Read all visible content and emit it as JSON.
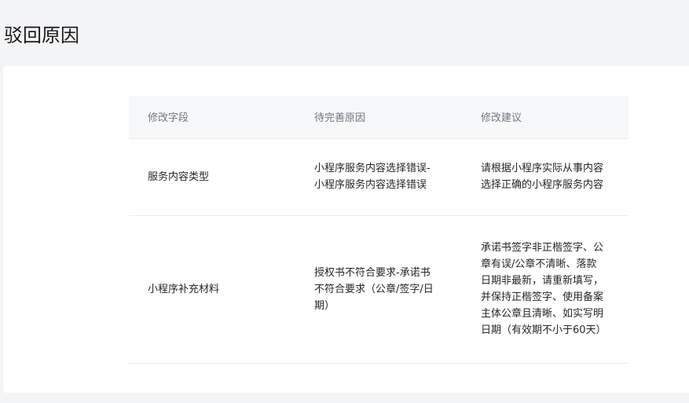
{
  "page": {
    "title": "驳回原因"
  },
  "table": {
    "headers": [
      "修改字段",
      "待完善原因",
      "修改建议"
    ],
    "rows": [
      {
        "field": "服务内容类型",
        "reason": "小程序服务内容选择错误-小程序服务内容选择错误",
        "suggestion": "请根据小程序实际从事内容选择正确的小程序服务内容"
      },
      {
        "field": "小程序补充材料",
        "reason": "授权书不符合要求-承诺书不符合要求（公章/签字/日期）",
        "suggestion": "承诺书签字非正楷签字、公章有误/公章不清晰、落款日期非最新，请重新填写，并保持正楷签字、使用备案主体公章且清晰、如实写明日期（有效期不小于60天）"
      }
    ]
  }
}
